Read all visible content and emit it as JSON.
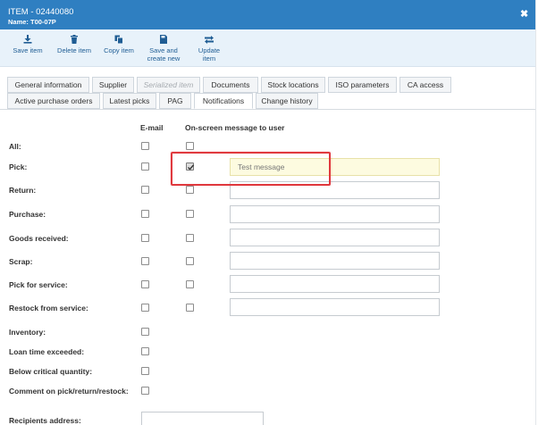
{
  "window": {
    "title": "ITEM - 02440080",
    "subtitle": "Name: T00-07P",
    "close_icon": "close-icon"
  },
  "toolbar": [
    {
      "name": "save-item-button",
      "icon": "save-icon",
      "label": "Save item"
    },
    {
      "name": "delete-item-button",
      "icon": "trash-icon",
      "label": "Delete item"
    },
    {
      "name": "copy-item-button",
      "icon": "copy-icon",
      "label": "Copy item"
    },
    {
      "name": "save-and-create-new-button",
      "icon": "save-new-icon",
      "label": "Save and create new"
    },
    {
      "name": "update-item-button",
      "icon": "arrows-exchange-icon",
      "label": "Update item"
    }
  ],
  "tabs_row1": [
    {
      "label": "General information",
      "state": "normal"
    },
    {
      "label": "Supplier",
      "state": "normal"
    },
    {
      "label": "Serialized item",
      "state": "disabled"
    },
    {
      "label": "Documents",
      "state": "normal"
    },
    {
      "label": "Stock locations",
      "state": "normal"
    },
    {
      "label": "ISO parameters",
      "state": "normal"
    },
    {
      "label": "CA access",
      "state": "normal"
    }
  ],
  "tabs_row2": [
    {
      "label": "Active purchase orders",
      "state": "normal"
    },
    {
      "label": "Latest picks",
      "state": "normal"
    },
    {
      "label": "PAG",
      "state": "normal"
    },
    {
      "label": "Notifications",
      "state": "active"
    },
    {
      "label": "Change history",
      "state": "normal"
    }
  ],
  "columns": {
    "email": "E-mail",
    "onscreen": "On-screen message to user"
  },
  "rows": [
    {
      "label": "All:",
      "email": false,
      "onscreen": false,
      "has_onscreen": true,
      "message": null
    },
    {
      "label": "Pick:",
      "email": false,
      "onscreen": true,
      "has_onscreen": true,
      "message": "",
      "placeholder": "Test message"
    },
    {
      "label": "Return:",
      "email": false,
      "onscreen": false,
      "has_onscreen": true,
      "message": ""
    },
    {
      "label": "Purchase:",
      "email": false,
      "onscreen": false,
      "has_onscreen": true,
      "message": ""
    },
    {
      "label": "Goods received:",
      "email": false,
      "onscreen": false,
      "has_onscreen": true,
      "message": ""
    },
    {
      "label": "Scrap:",
      "email": false,
      "onscreen": false,
      "has_onscreen": true,
      "message": ""
    },
    {
      "label": "Pick for service:",
      "email": false,
      "onscreen": false,
      "has_onscreen": true,
      "message": ""
    },
    {
      "label": "Restock from service:",
      "email": false,
      "onscreen": false,
      "has_onscreen": true,
      "message": ""
    },
    {
      "label": "Inventory:",
      "email": false,
      "has_onscreen": false
    },
    {
      "label": "Loan time exceeded:",
      "email": false,
      "has_onscreen": false
    },
    {
      "label": "Below critical quantity:",
      "email": false,
      "has_onscreen": false
    },
    {
      "label": "Comment on pick/return/restock:",
      "email": false,
      "has_onscreen": false
    }
  ],
  "recipients": {
    "label": "Recipients address:",
    "value": ""
  },
  "colors": {
    "titlebar": "#2f7fc1",
    "toolbar": "#e8f2fa",
    "highlight": "#e0393e",
    "input_highlight": "#fdfbe0"
  }
}
